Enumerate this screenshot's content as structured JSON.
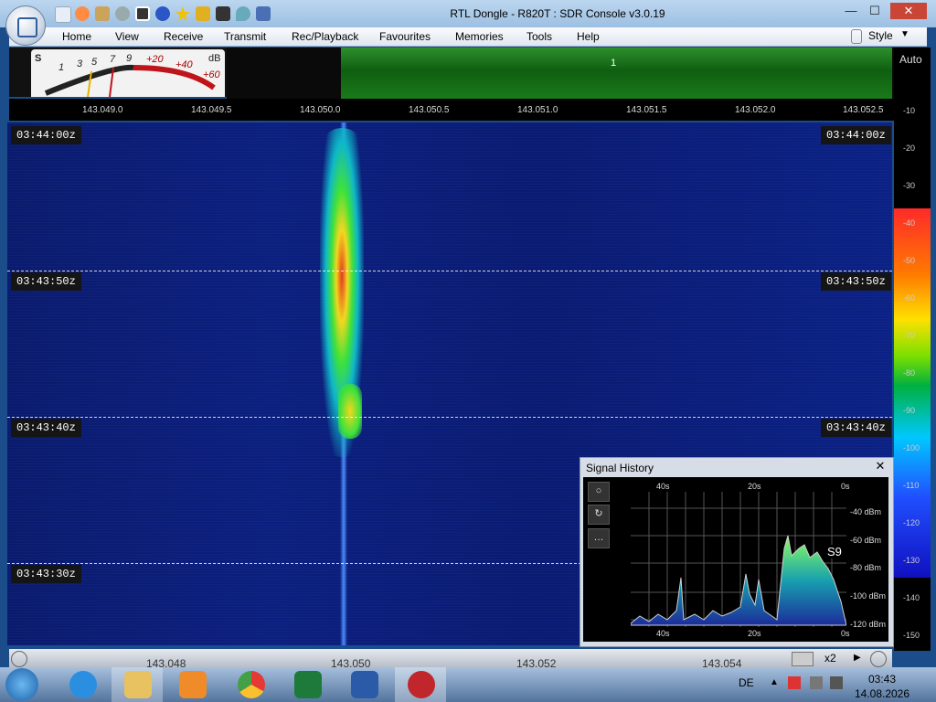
{
  "window": {
    "title": "RTL Dongle - R820T : SDR Console v3.0.19",
    "minimize": "—",
    "maximize": "☐",
    "close": "✕"
  },
  "menu": {
    "items": [
      "Home",
      "View",
      "Receive",
      "Transmit",
      "Rec/Playback",
      "Favourites",
      "Memories",
      "Tools",
      "Help"
    ],
    "style_label": "Style"
  },
  "meter": {
    "s_label": "S",
    "db_label": "dB",
    "scale": [
      "1",
      "3",
      "5",
      "7",
      "9",
      "+20",
      "+40",
      "+60"
    ]
  },
  "spectrum": {
    "band_label": "1"
  },
  "frequency_scale": [
    "143.049.0",
    "143.049.5",
    "143.050.0",
    "143.050.5",
    "143.051.0",
    "143.051.5",
    "143.052.0",
    "143.052.5"
  ],
  "waterfall": {
    "timestamps": [
      "03:44:00z",
      "03:43:50z",
      "03:43:40z",
      "03:43:30z"
    ]
  },
  "db_scale": {
    "auto_label": "Auto",
    "values": [
      "-10",
      "-20",
      "-30",
      "-40",
      "-50",
      "-60",
      "-70",
      "-80",
      "-90",
      "-100",
      "-110",
      "-120",
      "-130",
      "-140",
      "-150"
    ]
  },
  "signal_history": {
    "title": "Signal History",
    "close": "✕",
    "time_top": [
      "40s",
      "20s",
      "0s"
    ],
    "time_bottom": [
      "40s",
      "20s",
      "0s"
    ],
    "levels": [
      "-40 dBm",
      "-60 dBm",
      "-80 dBm",
      "-100 dBm",
      "-120 dBm"
    ],
    "s_reading": "S9",
    "buttons": [
      "○",
      "↻",
      "…"
    ]
  },
  "bottom": {
    "frequencies": [
      "143.048",
      "143.050",
      "143.052",
      "143.054"
    ],
    "zoom": "x2"
  },
  "taskbar": {
    "language": "DE",
    "time": "03:43",
    "date": "14.08.2026"
  },
  "colors": {
    "accent": "#1a7a1a",
    "waterfall": "#0b2080",
    "signal_peak": "#e23b1f"
  }
}
